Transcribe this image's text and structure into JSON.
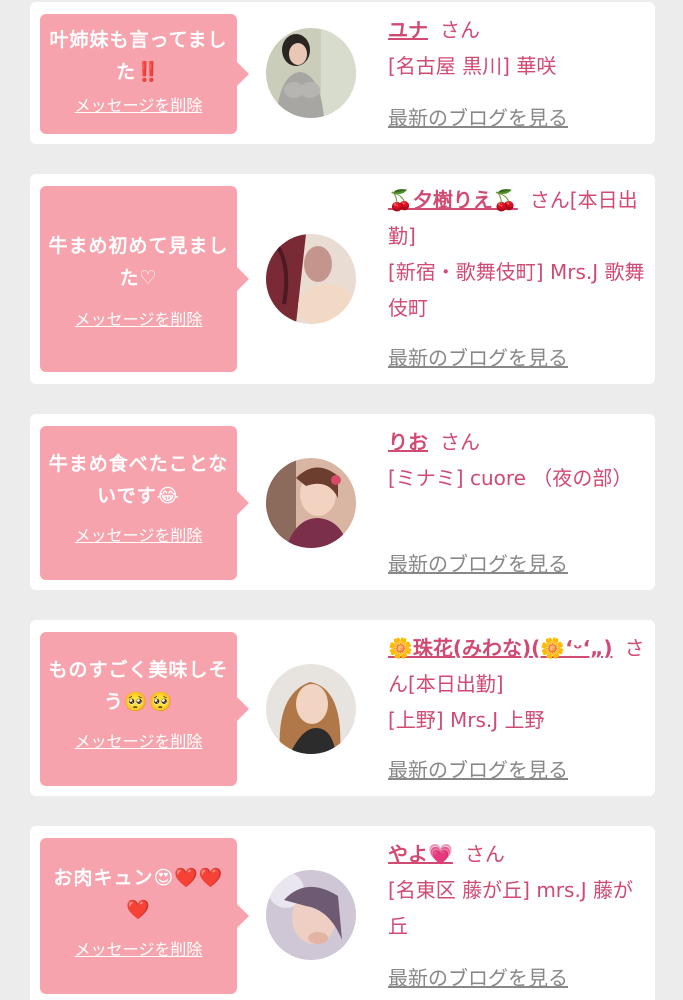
{
  "delete_label": "メッセージを削除",
  "blog_label": "最新のブログを見る",
  "san_label": "さん",
  "colors": {
    "bubble": "#f7a3ad",
    "accent": "#d14a72",
    "link_gray": "#888888",
    "background": "#ececec"
  },
  "cards": [
    {
      "message": "叶姉妹も言ってました‼️",
      "name": "ユナ",
      "san": "さん",
      "location": "[名古屋 黒川] 華咲"
    },
    {
      "message": "牛まめ初めて見ました♡",
      "name": "🍒夕樹りえ🍒",
      "san": "さん[本日出勤]",
      "location": "[新宿・歌舞伎町] Mrs.J 歌舞伎町"
    },
    {
      "message": "牛まめ食べたことないです😂",
      "name": "りお",
      "san": "さん",
      "location": "[ミナミ] cuore （夜の部）"
    },
    {
      "message": "ものすごく美味しそう🥺🥺",
      "name": "🌼珠花(みわな)(🌼‘ᵕ‘„)",
      "san": "さん[本日出勤]",
      "location": "[上野] Mrs.J 上野"
    },
    {
      "message": "お肉キュン😍❤️❤️❤️",
      "name": "やよ💗",
      "san": "さん",
      "location": "[名東区 藤が丘] mrs.J 藤が丘"
    }
  ]
}
